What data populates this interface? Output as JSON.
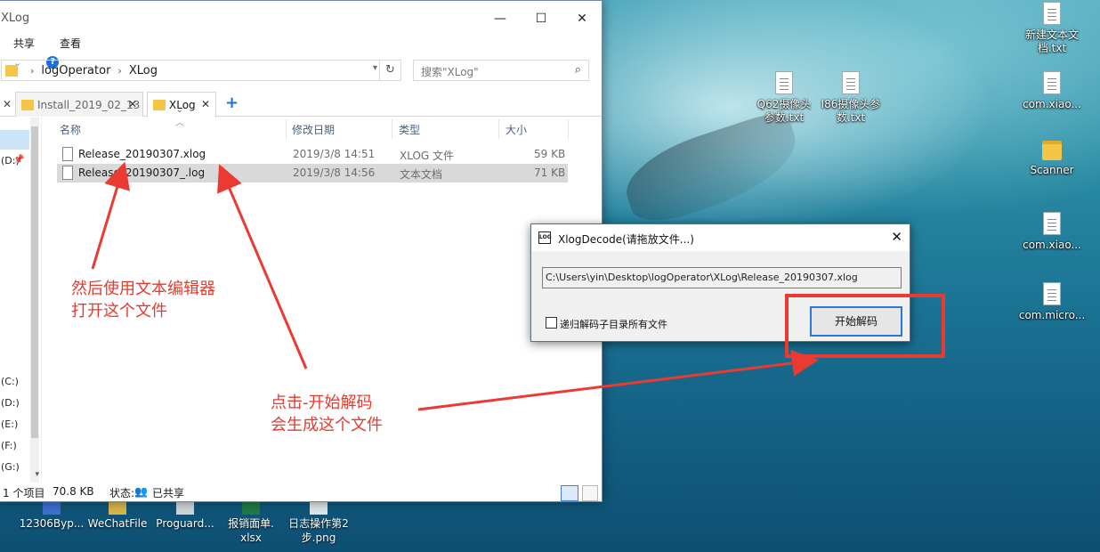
{
  "desktop": {
    "icons_right": [
      {
        "label": "新建文本文档.txt",
        "line1": "新建文本文",
        "line2": "档.txt",
        "kind": "doc"
      },
      {
        "label": "com.xiao...",
        "line1": "com.xiao...",
        "line2": "",
        "kind": "doc"
      },
      {
        "label": "Scanner",
        "line1": "Scanner",
        "line2": "",
        "kind": "folder"
      },
      {
        "label": "com.xiao...",
        "line1": "com.xiao...",
        "line2": "",
        "kind": "doc"
      },
      {
        "label": "com.micro...",
        "line1": "com.micro...",
        "line2": "",
        "kind": "doc"
      }
    ],
    "icons_middle": [
      {
        "line1": "Q62摄像头",
        "line2": "参数.txt"
      },
      {
        "line1": "I86摄像头参",
        "line2": "数.txt"
      }
    ],
    "icons_bottom": [
      {
        "line1": "12306Byp...",
        "line2": ""
      },
      {
        "line1": "WeChatFile",
        "line2": ""
      },
      {
        "line1": "Proguard...",
        "line2": ""
      },
      {
        "line1": "报销面单.",
        "line2": "xlsx"
      },
      {
        "line1": "日志操作第2",
        "line2": "步.png"
      }
    ]
  },
  "explorer": {
    "title": "XLog",
    "window_buttons": {
      "minimize": "—",
      "maximize": "☐",
      "close": "✕"
    },
    "ribbon": {
      "share": "共享",
      "view": "查看"
    },
    "address": {
      "segments": [
        "logOperator",
        "XLog"
      ]
    },
    "search": {
      "placeholder": "搜索\"XLog\""
    },
    "tabs": [
      {
        "label": "Install_2019_02_13",
        "active": false
      },
      {
        "label": "XLog",
        "active": true
      }
    ],
    "nav_drives": [
      {
        "label": "(D:)",
        "pinned": true
      },
      {
        "label": "(C:)"
      },
      {
        "label": "(D:)"
      },
      {
        "label": "(E:)"
      },
      {
        "label": "(F:)"
      },
      {
        "label": "(G:)"
      }
    ],
    "columns": {
      "name": "名称",
      "modified": "修改日期",
      "type": "类型",
      "size": "大小"
    },
    "files": [
      {
        "name": "Release_20190307.xlog",
        "modified": "2019/3/8 14:51",
        "type": "XLOG 文件",
        "size": "59 KB",
        "selected": false
      },
      {
        "name": "Release_20190307_.log",
        "modified": "2019/3/8 14:56",
        "type": "文本文档",
        "size": "71 KB",
        "selected": true
      }
    ],
    "status": {
      "items": "1 个项目",
      "size": "70.8 KB",
      "state_label": "状态:",
      "state_value": "已共享"
    }
  },
  "dialog": {
    "title": "XlogDecode(请拖放文件...)",
    "close": "✕",
    "icon_text": "LOG",
    "path_value": "C:\\Users\\yin\\Desktop\\logOperator\\XLog\\Release_20190307.xlog",
    "recursive_label": "递归解码子目录所有文件",
    "recursive_checked": false,
    "start_button": "开始解码"
  },
  "annotations": {
    "note1_line1": "然后使用文本编辑器",
    "note1_line2": "打开这个文件",
    "note2_line1": "点击-开始解码",
    "note2_line2": "会生成这个文件",
    "color": "#e53a2d"
  }
}
